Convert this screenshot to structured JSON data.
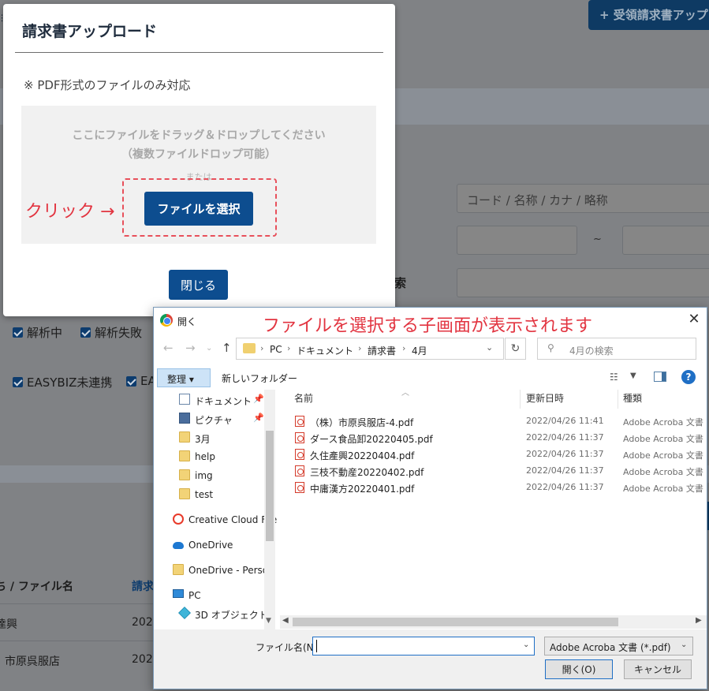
{
  "background": {
    "upload_button_label": "+ 受領請求書アップ",
    "keyword_placeholder": "コード / 名称 / カナ / 略称",
    "range_separator": "~",
    "search_label": "索",
    "checks": [
      "解析中",
      "解析失敗",
      "EASYBIZ未連携",
      "EA"
    ],
    "table_headers": [
      "ち / ファイル名",
      "請求"
    ],
    "rows": [
      {
        "name": "達興",
        "date": "2022"
      },
      {
        "name": "市原呉服店",
        "date": "2022"
      }
    ]
  },
  "modal": {
    "title": "請求書アップロード",
    "note": "※ PDF形式のファイルのみ対応",
    "drop_text_1": "ここにファイルをドラッグ＆ドロップしてください",
    "drop_text_2": "（複数ファイルドロップ可能）",
    "drop_or": "または",
    "select_button": "ファイルを選択",
    "close_button": "閉じる",
    "click_annotation": "クリック →"
  },
  "dialog": {
    "title": "開く",
    "annotation": "ファイルを選択する子画面が表示されます",
    "breadcrumb": [
      "PC",
      "ドキュメント",
      "請求書",
      "4月"
    ],
    "search_placeholder": "4月の検索",
    "organize_label": "整理 ▾",
    "new_folder_label": "新しいフォルダー",
    "nav_items": [
      {
        "label": "ドキュメント",
        "icon": "doc",
        "pinned": true
      },
      {
        "label": "ピクチャ",
        "icon": "pic",
        "pinned": true
      },
      {
        "label": "3月",
        "icon": "folder"
      },
      {
        "label": "help",
        "icon": "folder"
      },
      {
        "label": "img",
        "icon": "folder"
      },
      {
        "label": "test",
        "icon": "folder"
      },
      {
        "label": "Creative Cloud File",
        "icon": "cc"
      },
      {
        "label": "OneDrive",
        "icon": "cloud"
      },
      {
        "label": "OneDrive - Person",
        "icon": "folder"
      },
      {
        "label": "PC",
        "icon": "pc"
      },
      {
        "label": "3D オブジェクト",
        "icon": "obj3d"
      }
    ],
    "columns": {
      "name": "名前",
      "date": "更新日時",
      "type": "種類"
    },
    "files": [
      {
        "name": "（株）市原呉服店-4.pdf",
        "date": "2022/04/26 11:41",
        "type": "Adobe Acroba 文書"
      },
      {
        "name": "ダース食品卸20220405.pdf",
        "date": "2022/04/26 11:37",
        "type": "Adobe Acroba 文書"
      },
      {
        "name": "久住產興20220404.pdf",
        "date": "2022/04/26 11:37",
        "type": "Adobe Acroba 文書"
      },
      {
        "name": "三枝不動産20220402.pdf",
        "date": "2022/04/26 11:37",
        "type": "Adobe Acroba 文書"
      },
      {
        "name": "中庸漢方20220401.pdf",
        "date": "2022/04/26 11:37",
        "type": "Adobe Acroba 文書"
      }
    ],
    "filename_label": "ファイル名(N):",
    "filename_value": "",
    "filetype_value": "Adobe Acroba 文書 (*.pdf)",
    "open_button": "開く(O)",
    "cancel_button": "キャンセル"
  }
}
